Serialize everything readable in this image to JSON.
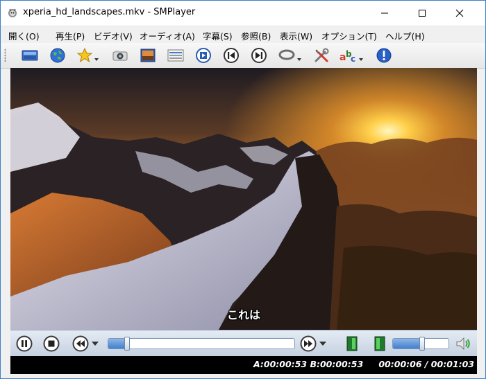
{
  "window": {
    "title": "xperia_hd_landscapes.mkv - SMPlayer",
    "controls": [
      "minimize",
      "maximize",
      "close"
    ]
  },
  "menu": {
    "items": [
      "開く(O)",
      "再生(P)",
      "ビデオ(V)",
      "オーディオ(A)",
      "字幕(S)",
      "参照(B)",
      "表示(W)",
      "オプション(T)",
      "ヘルプ(H)"
    ]
  },
  "toolbar": {
    "icons": [
      "screen-icon",
      "globe-icon",
      "favorites-star-icon",
      "screenshot-camera-icon",
      "video-equalizer-icon",
      "playlist-icon",
      "frame-step-icon",
      "previous-chapter-icon",
      "next-chapter-icon",
      "ab-repeat-icon",
      "preferences-tools-icon",
      "subtitle-abc-icon",
      "info-icon"
    ]
  },
  "video": {
    "subtitle": "これは"
  },
  "controls": {
    "buttons": [
      "pause-icon",
      "stop-icon",
      "rewind-icon",
      "forward-icon",
      "fullscreen-left-icon",
      "fullscreen-right-icon",
      "volume-speaker-icon"
    ],
    "seek_fraction": 0.1,
    "volume_fraction": 0.52
  },
  "status": {
    "ab_repeat": "A:00:00:53 B:00:00:53",
    "time": "00:00:06 / 00:01:03"
  },
  "colors": {
    "accent": "#3f7fcf",
    "window_border": "#3c7fc8",
    "status_bg": "#000000",
    "status_text": "#ffffff"
  }
}
